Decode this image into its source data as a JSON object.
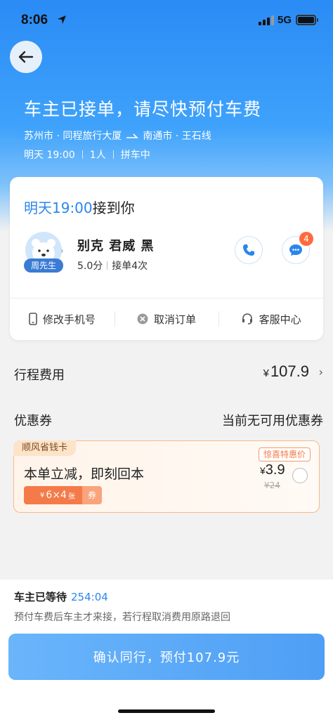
{
  "status_bar": {
    "time": "8:06",
    "network": "5G"
  },
  "header": {
    "title": "车主已接单，请尽快预付车费",
    "route": {
      "origin": "苏州市 · 同程旅行大厦",
      "destination": "南通市 · 王石线"
    },
    "meta": {
      "time": "明天 19:00",
      "passengers": "1人",
      "mode": "拼车中"
    }
  },
  "driver_card": {
    "pickup_time": "明天19:00",
    "pickup_suffix": "接到你",
    "avatar_name": "周先生",
    "car": "别克 君威 黑",
    "rating": "5.0分",
    "orders": "接单4次",
    "message_badge": "4",
    "actions": [
      {
        "label": "修改手机号",
        "icon": "phone-device-icon"
      },
      {
        "label": "取消订单",
        "icon": "close-circle-icon"
      },
      {
        "label": "客服中心",
        "icon": "headset-icon"
      }
    ]
  },
  "fee": {
    "label": "行程费用",
    "currency": "¥",
    "amount": "107.9",
    "chevron": "›"
  },
  "coupon": {
    "label": "优惠券",
    "status": "当前无可用优惠券"
  },
  "promo": {
    "tag": "顺风省钱卡",
    "badge": "惊喜特惠价",
    "headline": "本单立减，即刻回本",
    "chip_currency": "¥",
    "chip_value": "6×4",
    "chip_unit": "张",
    "chip_suffix": "券",
    "price_currency": "¥",
    "price": "3.9",
    "original_price": "¥24",
    "colors": {
      "accent": "#f47b49",
      "border": "#f6b98a"
    }
  },
  "bottom": {
    "wait_label": "车主已等待",
    "wait_time": "254:04",
    "refund_note": "预付车费后车主才来接，若行程取消费用原路退回",
    "confirm_label": "确认同行，预付107.9元"
  },
  "colors": {
    "primary": "#2b86ec",
    "hero_top": "#2a8bf5"
  }
}
